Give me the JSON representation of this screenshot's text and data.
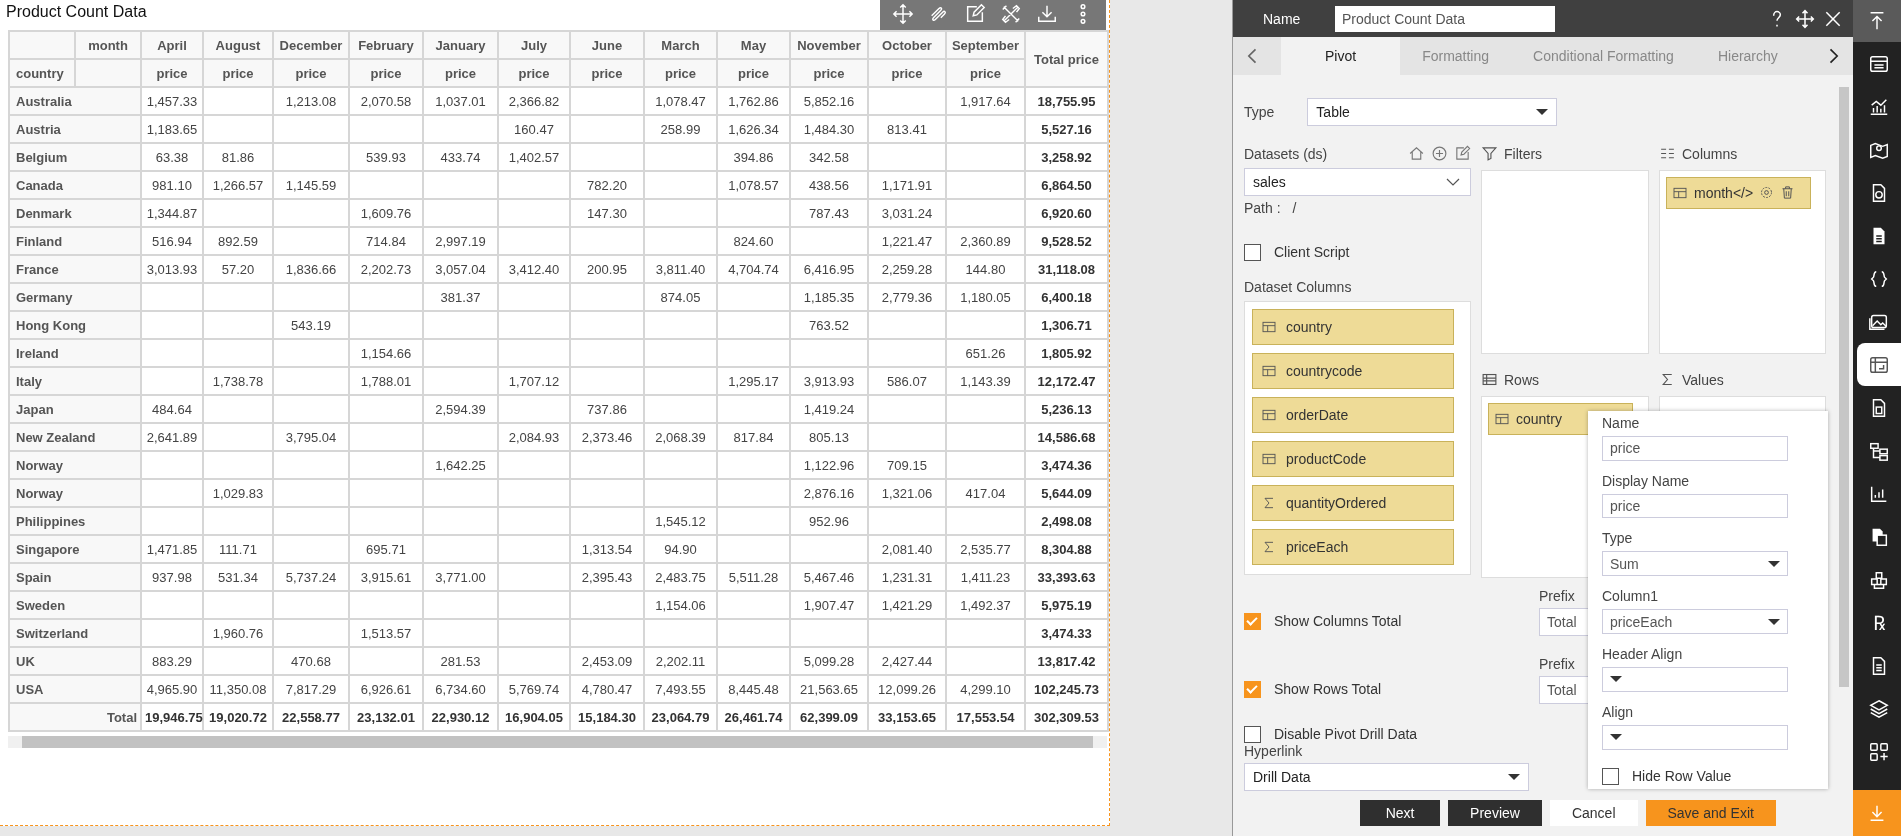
{
  "widget": {
    "title": "Product Count Data",
    "table": {
      "corner_column": "month",
      "row_header": "country",
      "months": [
        "April",
        "August",
        "December",
        "February",
        "January",
        "July",
        "June",
        "March",
        "May",
        "November",
        "October",
        "September"
      ],
      "measures": [
        "price",
        "price",
        "price",
        "price",
        "price",
        "price",
        "price",
        "price",
        "price",
        "price",
        "price",
        "price"
      ],
      "total_header": "Total price",
      "rows": [
        {
          "label": "Australia",
          "cells": [
            "1,457.33",
            null,
            "1,213.08",
            "2,070.58",
            "1,037.01",
            "2,366.82",
            null,
            "1,078.47",
            "1,762.86",
            "5,852.16",
            null,
            "1,917.64"
          ],
          "total": "18,755.95"
        },
        {
          "label": "Austria",
          "cells": [
            "1,183.65",
            null,
            null,
            null,
            null,
            "160.47",
            null,
            "258.99",
            "1,626.34",
            "1,484.30",
            "813.41",
            null
          ],
          "total": "5,527.16"
        },
        {
          "label": "Belgium",
          "cells": [
            "63.38",
            "81.86",
            null,
            "539.93",
            "433.74",
            "1,402.57",
            null,
            null,
            "394.86",
            "342.58",
            null,
            null
          ],
          "total": "3,258.92"
        },
        {
          "label": "Canada",
          "cells": [
            "981.10",
            "1,266.57",
            "1,145.59",
            null,
            null,
            null,
            "782.20",
            null,
            "1,078.57",
            "438.56",
            "1,171.91",
            null
          ],
          "total": "6,864.50"
        },
        {
          "label": "Denmark",
          "cells": [
            "1,344.87",
            null,
            null,
            "1,609.76",
            null,
            null,
            "147.30",
            null,
            null,
            "787.43",
            "3,031.24",
            null
          ],
          "total": "6,920.60"
        },
        {
          "label": "Finland",
          "cells": [
            "516.94",
            "892.59",
            null,
            "714.84",
            "2,997.19",
            null,
            null,
            null,
            "824.60",
            null,
            "1,221.47",
            "2,360.89"
          ],
          "total": "9,528.52"
        },
        {
          "label": "France",
          "cells": [
            "3,013.93",
            "57.20",
            "1,836.66",
            "2,202.73",
            "3,057.04",
            "3,412.40",
            "200.95",
            "3,811.40",
            "4,704.74",
            "6,416.95",
            "2,259.28",
            "144.80"
          ],
          "total": "31,118.08"
        },
        {
          "label": "Germany",
          "cells": [
            null,
            null,
            null,
            null,
            "381.37",
            null,
            null,
            "874.05",
            null,
            "1,185.35",
            "2,779.36",
            "1,180.05"
          ],
          "total": "6,400.18"
        },
        {
          "label": "Hong Kong",
          "cells": [
            null,
            null,
            "543.19",
            null,
            null,
            null,
            null,
            null,
            null,
            "763.52",
            null,
            null
          ],
          "total": "1,306.71"
        },
        {
          "label": "Ireland",
          "cells": [
            null,
            null,
            null,
            "1,154.66",
            null,
            null,
            null,
            null,
            null,
            null,
            null,
            "651.26"
          ],
          "total": "1,805.92"
        },
        {
          "label": "Italy",
          "cells": [
            null,
            "1,738.78",
            null,
            "1,788.01",
            null,
            "1,707.12",
            null,
            null,
            "1,295.17",
            "3,913.93",
            "586.07",
            "1,143.39"
          ],
          "total": "12,172.47"
        },
        {
          "label": "Japan",
          "cells": [
            "484.64",
            null,
            null,
            null,
            "2,594.39",
            null,
            "737.86",
            null,
            null,
            "1,419.24",
            null,
            null
          ],
          "total": "5,236.13"
        },
        {
          "label": "New Zealand",
          "cells": [
            "2,641.89",
            null,
            "3,795.04",
            null,
            null,
            "2,084.93",
            "2,373.46",
            "2,068.39",
            "817.84",
            "805.13",
            null,
            null
          ],
          "total": "14,586.68"
        },
        {
          "label": "Norway",
          "cells": [
            null,
            null,
            null,
            null,
            "1,642.25",
            null,
            null,
            null,
            null,
            "1,122.96",
            "709.15",
            null
          ],
          "total": "3,474.36"
        },
        {
          "label": "Norway",
          "cells": [
            null,
            "1,029.83",
            null,
            null,
            null,
            null,
            null,
            null,
            null,
            "2,876.16",
            "1,321.06",
            "417.04"
          ],
          "total": "5,644.09"
        },
        {
          "label": "Philippines",
          "cells": [
            null,
            null,
            null,
            null,
            null,
            null,
            null,
            "1,545.12",
            null,
            "952.96",
            null,
            null
          ],
          "total": "2,498.08"
        },
        {
          "label": "Singapore",
          "cells": [
            "1,471.85",
            "111.71",
            null,
            "695.71",
            null,
            null,
            "1,313.54",
            "94.90",
            null,
            null,
            "2,081.40",
            "2,535.77"
          ],
          "total": "8,304.88"
        },
        {
          "label": "Spain",
          "cells": [
            "937.98",
            "531.34",
            "5,737.24",
            "3,915.61",
            "3,771.00",
            null,
            "2,395.43",
            "2,483.75",
            "5,511.28",
            "5,467.46",
            "1,231.31",
            "1,411.23"
          ],
          "total": "33,393.63"
        },
        {
          "label": "Sweden",
          "cells": [
            null,
            null,
            null,
            null,
            null,
            null,
            null,
            "1,154.06",
            null,
            "1,907.47",
            "1,421.29",
            "1,492.37"
          ],
          "total": "5,975.19"
        },
        {
          "label": "Switzerland",
          "cells": [
            null,
            "1,960.76",
            null,
            "1,513.57",
            null,
            null,
            null,
            null,
            null,
            null,
            null,
            null
          ],
          "total": "3,474.33"
        },
        {
          "label": "UK",
          "cells": [
            "883.29",
            null,
            "470.68",
            null,
            "281.53",
            null,
            "2,453.09",
            "2,202.11",
            null,
            "5,099.28",
            "2,427.44",
            null
          ],
          "total": "13,817.42"
        },
        {
          "label": "USA",
          "cells": [
            "4,965.90",
            "11,350.08",
            "7,817.29",
            "6,926.61",
            "6,734.60",
            "5,769.74",
            "4,780.47",
            "7,493.55",
            "8,445.48",
            "21,563.65",
            "12,099.26",
            "4,299.10"
          ],
          "total": "102,245.73"
        }
      ],
      "totals": {
        "label": "Total",
        "cells": [
          "19,946.75",
          "19,020.72",
          "22,558.77",
          "23,132.01",
          "22,930.12",
          "16,904.05",
          "15,184.30",
          "23,064.79",
          "26,461.74",
          "62,399.09",
          "33,153.65",
          "17,553.54"
        ],
        "total": "302,309.53"
      }
    }
  },
  "panel": {
    "name_label": "Name",
    "name_value": "Product Count Data",
    "tabs": [
      {
        "label": "Pivot",
        "selected": true
      },
      {
        "label": "Formatting",
        "selected": false
      },
      {
        "label": "Conditional Formatting",
        "selected": false
      },
      {
        "label": "Hierarchy",
        "selected": false
      }
    ],
    "type": {
      "label": "Type",
      "value": "Table"
    },
    "datasets": {
      "label": "Datasets (ds)",
      "value": "sales",
      "path_label": "Path :",
      "path": "/"
    },
    "client_script": {
      "label": "Client Script",
      "checked": false
    },
    "dataset_columns": {
      "label": "Dataset Columns",
      "items": [
        {
          "label": "country",
          "kind": "dimension"
        },
        {
          "label": "countrycode",
          "kind": "dimension"
        },
        {
          "label": "orderDate",
          "kind": "dimension"
        },
        {
          "label": "productCode",
          "kind": "dimension"
        },
        {
          "label": "quantityOrdered",
          "kind": "measure"
        },
        {
          "label": "priceEach",
          "kind": "measure"
        }
      ]
    },
    "filters": {
      "label": "Filters"
    },
    "columns": {
      "label": "Columns",
      "chip": {
        "label": "month",
        "glyph": "</>"
      }
    },
    "rows": {
      "label": "Rows",
      "chip": {
        "label": "country"
      }
    },
    "values": {
      "label": "Values"
    },
    "show_columns_total": {
      "label": "Show Columns Total",
      "checked": true,
      "prefix_label": "Prefix",
      "prefix_value": "Total"
    },
    "show_rows_total": {
      "label": "Show Rows Total",
      "checked": true,
      "prefix_label": "Prefix",
      "prefix_value": "Total"
    },
    "disable_drill": {
      "label": "Disable Pivot Drill Data",
      "checked": false
    },
    "hyperlink": {
      "label": "Hyperlink",
      "value": "Drill Data"
    },
    "popup": {
      "name_label": "Name",
      "name_value": "price",
      "display_label": "Display Name",
      "display_value": "price",
      "type_label": "Type",
      "type_value": "Sum",
      "column_label": "Column1",
      "column_value": "priceEach",
      "header_align_label": "Header Align",
      "align_label": "Align",
      "hide_row": {
        "label": "Hide Row Value",
        "checked": false
      }
    },
    "buttons": [
      {
        "label": "Next",
        "kind": "dark"
      },
      {
        "label": "Preview",
        "kind": "dark"
      },
      {
        "label": "Cancel",
        "kind": "plain"
      },
      {
        "label": "Save and Exit",
        "kind": "primary"
      }
    ]
  },
  "rail": [
    {
      "selected": false
    },
    {
      "selected": false
    },
    {
      "selected": false
    },
    {
      "selected": false
    },
    {
      "selected": false
    },
    {
      "selected": false
    },
    {
      "selected": false
    },
    {
      "selected": true
    },
    {
      "selected": false
    },
    {
      "selected": false
    },
    {
      "selected": false
    },
    {
      "selected": false
    },
    {
      "selected": false
    },
    {
      "glyph": "℞",
      "selected": false
    },
    {
      "selected": false
    },
    {
      "selected": false
    },
    {
      "selected": false
    }
  ]
}
